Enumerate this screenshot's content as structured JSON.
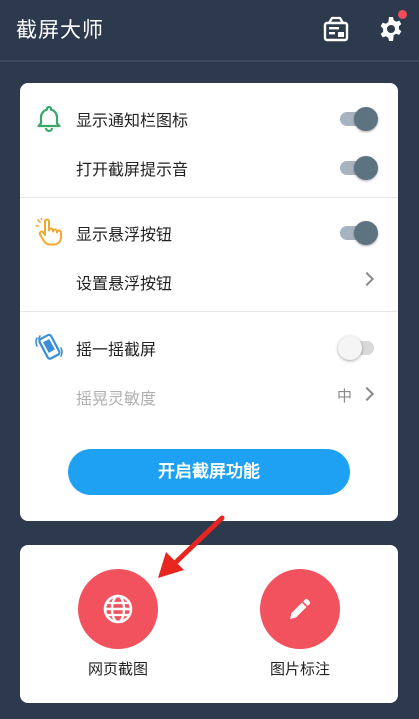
{
  "header": {
    "title": "截屏大师",
    "gallery_icon": "photo-album-icon",
    "settings_icon": "gear-icon",
    "notification_dot_color": "#f24b5c"
  },
  "settings": {
    "rows": [
      {
        "icon": "bell-icon",
        "label": "显示通知栏图标",
        "toggle": true
      },
      {
        "label": "打开截屏提示音",
        "toggle": true
      },
      {
        "icon": "pointing-hand-icon",
        "label": "显示悬浮按钮",
        "toggle": true
      },
      {
        "label": "设置悬浮按钮",
        "chevron": true
      },
      {
        "icon": "shake-phone-icon",
        "label": "摇一摇截屏",
        "toggle": false
      },
      {
        "label": "摇晃灵敏度",
        "value": "中",
        "chevron": true,
        "disabled": true
      }
    ],
    "start_button": "开启截屏功能"
  },
  "tools": [
    {
      "icon": "globe-icon",
      "label": "网页截图",
      "color": "#f2525e"
    },
    {
      "icon": "pencil-icon",
      "label": "图片标注",
      "color": "#f2525e"
    }
  ],
  "colors": {
    "background": "#2d3a4e",
    "accent": "#1ea1f3",
    "bell_green": "#3aa76d",
    "hand_orange": "#f0a830",
    "shake_blue": "#3a8fd8",
    "annotation_red": "#e8261f"
  }
}
